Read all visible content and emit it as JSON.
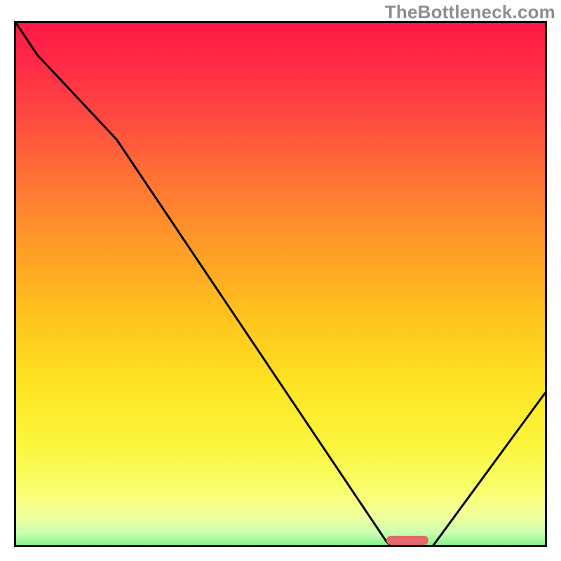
{
  "watermark": "TheBottleneck.com",
  "chart_data": {
    "type": "line",
    "x": [
      0,
      4,
      19,
      70,
      72,
      78,
      100
    ],
    "y": [
      100,
      94,
      78,
      2,
      0,
      0,
      30
    ],
    "xlim": [
      0,
      100
    ],
    "ylim": [
      0,
      100
    ],
    "title": "",
    "xlabel": "",
    "ylabel": "",
    "background_gradient": {
      "stops": [
        {
          "pos": 0.0,
          "color": "#ff1a45"
        },
        {
          "pos": 0.08,
          "color": "#ff2b46"
        },
        {
          "pos": 0.18,
          "color": "#ff4a40"
        },
        {
          "pos": 0.3,
          "color": "#ff7534"
        },
        {
          "pos": 0.42,
          "color": "#ff9b28"
        },
        {
          "pos": 0.55,
          "color": "#ffc21d"
        },
        {
          "pos": 0.68,
          "color": "#fde322"
        },
        {
          "pos": 0.8,
          "color": "#fbf63e"
        },
        {
          "pos": 0.88,
          "color": "#faff6b"
        },
        {
          "pos": 0.93,
          "color": "#f2ff9a"
        },
        {
          "pos": 0.965,
          "color": "#c9ffb0"
        },
        {
          "pos": 0.985,
          "color": "#8af590"
        },
        {
          "pos": 1.0,
          "color": "#2fe783"
        }
      ]
    },
    "marker": {
      "x_start_pct": 70,
      "x_end_pct": 78,
      "height_pct": 1.8,
      "color": "#e4676b"
    }
  }
}
